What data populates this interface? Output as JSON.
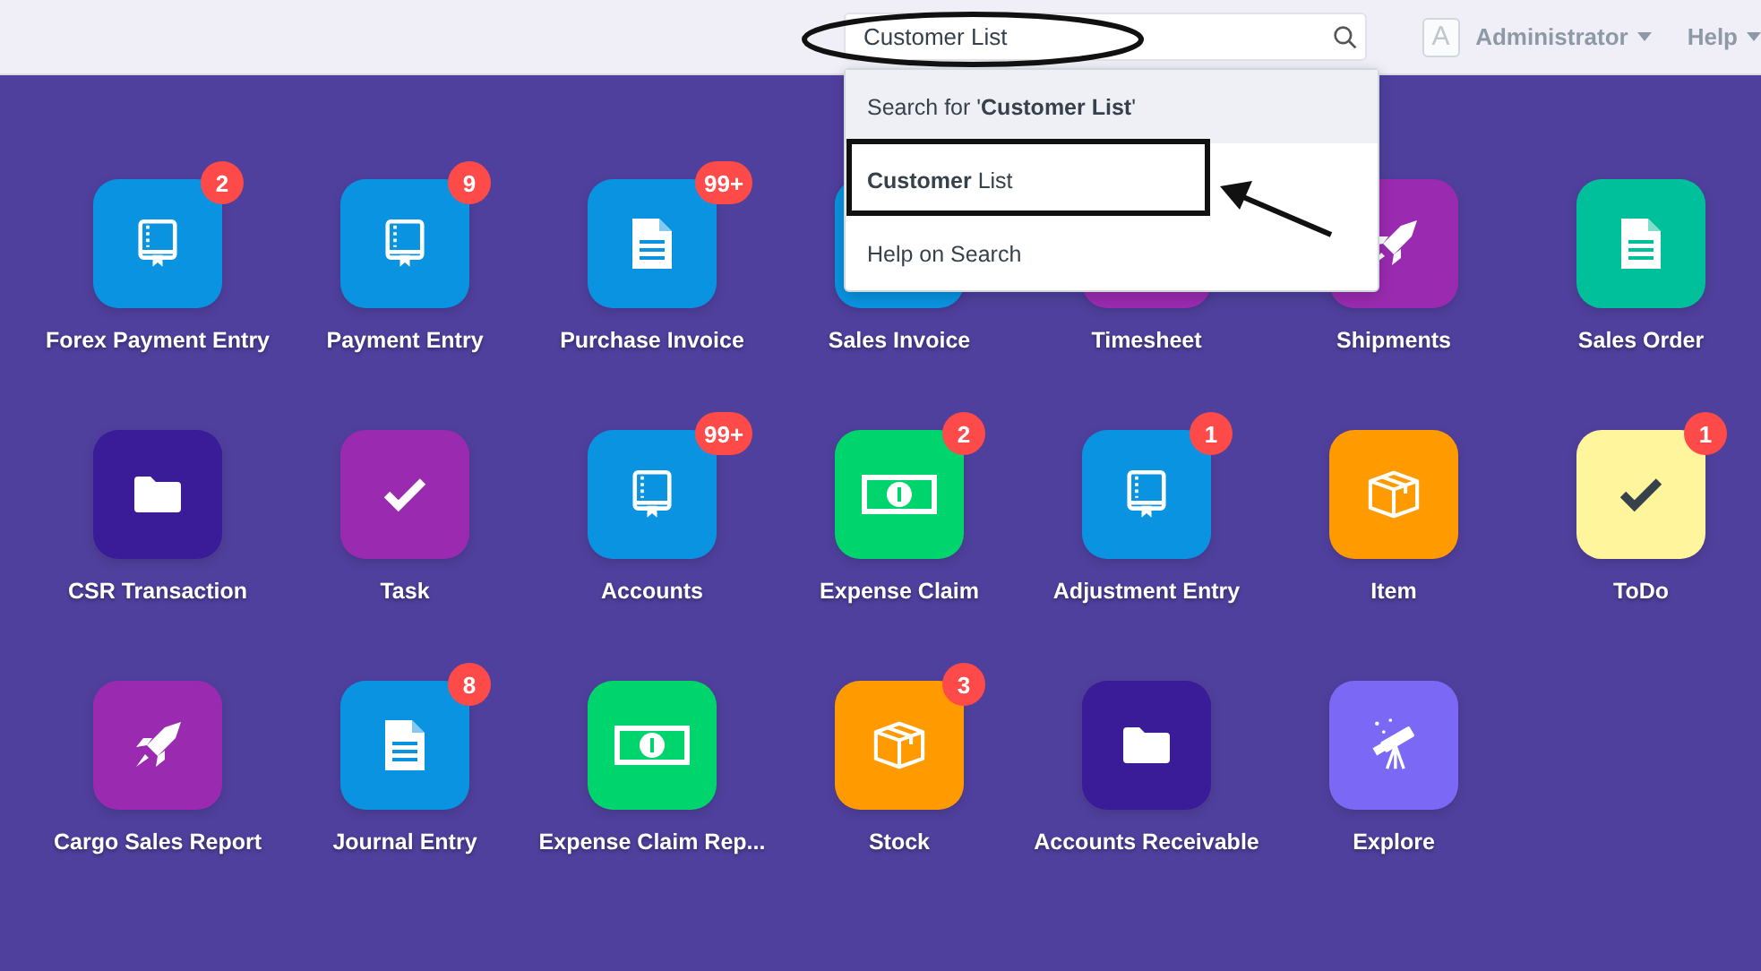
{
  "navbar": {
    "search": {
      "value": "Customer List"
    },
    "search_results": [
      {
        "text": "Search for '**Customer List**'",
        "selected": true
      },
      {
        "text": "**Customer** List",
        "selected": false
      },
      {
        "text": "Help on Search",
        "selected": false
      }
    ],
    "user": {
      "avatar": "A",
      "name": "Administrator"
    },
    "help": "Help"
  },
  "apps": [
    {
      "label": "Forex Payment Entry",
      "color": "#0a93e0",
      "kind": "book",
      "badge": "2"
    },
    {
      "label": "Payment Entry",
      "color": "#0a93e0",
      "kind": "book",
      "badge": "9"
    },
    {
      "label": "Purchase Invoice",
      "color": "#0a93e0",
      "kind": "doc",
      "badge": "99+"
    },
    {
      "label": "Sales Invoice",
      "color": "#0a93e0"
    },
    {
      "label": "Timesheet",
      "color": "#9a2bb0"
    },
    {
      "label": "Shipments",
      "color": "#9a2bb0",
      "kind": "rocket"
    },
    {
      "label": "Sales Order",
      "color": "#00bf9b",
      "kind": "doc"
    },
    {
      "label": "CSR Transaction",
      "color": "#3a1c98",
      "kind": "folder"
    },
    {
      "label": "Task",
      "color": "#9a2bb0",
      "kind": "check"
    },
    {
      "label": "Accounts",
      "color": "#0a93e0",
      "kind": "book",
      "badge": "99+"
    },
    {
      "label": "Expense Claim",
      "color": "#00d46c",
      "kind": "money",
      "badge": "2"
    },
    {
      "label": "Adjustment Entry",
      "color": "#0a93e0",
      "kind": "book",
      "badge": "1"
    },
    {
      "label": "Item",
      "color": "#ff9a00",
      "kind": "box"
    },
    {
      "label": "ToDo",
      "color": "#fff59c",
      "kind": "check-dark",
      "badge": "1"
    },
    {
      "label": "Cargo Sales Report",
      "color": "#9a2bb0",
      "kind": "rocket"
    },
    {
      "label": "Journal Entry",
      "color": "#0a93e0",
      "kind": "doc",
      "badge": "8"
    },
    {
      "label": "Expense Claim Rep...",
      "color": "#00d46c",
      "kind": "money"
    },
    {
      "label": "Stock",
      "color": "#ff9a00",
      "kind": "box",
      "badge": "3"
    },
    {
      "label": "Accounts Receivable",
      "color": "#3a1c98",
      "kind": "folder"
    },
    {
      "label": "Explore",
      "color": "#7b68f5",
      "kind": "telescope"
    }
  ],
  "annotations": [
    {
      "kind": "ellipse"
    },
    {
      "kind": "rectangle"
    },
    {
      "kind": "arrow"
    }
  ]
}
